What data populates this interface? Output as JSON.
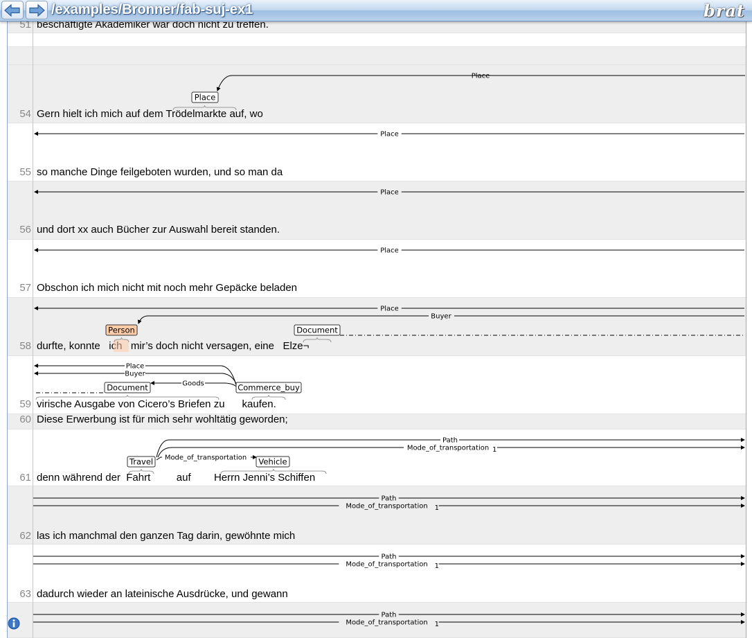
{
  "window": {
    "document_path": "/examples/Bronner/fab-suj-ex1",
    "logo": "brat",
    "nav_icons": [
      "left-arrow-icon",
      "right-arrow-icon"
    ],
    "info_icon": "info-icon"
  },
  "colors": {
    "row_even": "#eeeeee",
    "row_odd": "#ffffff",
    "span_default": "#ffffff",
    "span_person": "#ffccaa",
    "arc": "#000000"
  },
  "sentences": [
    {
      "num": "51",
      "text": "beschäftigte Akademiker war doch nicht zu treffen.",
      "shaded": true
    },
    {
      "num": "",
      "text": "",
      "shaded": false
    },
    {
      "num": "54",
      "text": "Gern hielt ich mich auf dem Trödelmarkte auf, wo",
      "shaded": true
    },
    {
      "num": "55",
      "text": "so manche Dinge feilgeboten wurden, und so man da",
      "shaded": false
    },
    {
      "num": "56",
      "text": "und dort xx auch Bücher zur Auswahl bereit standen.",
      "shaded": true
    },
    {
      "num": "57",
      "text": "Obschon ich mich nicht mit noch mehr Gepäcke beladen",
      "shaded": false
    },
    {
      "num": "58",
      "text": "durfte, konnte   ich   mir’s doch nicht versagen, eine   Elze¬",
      "shaded": true
    },
    {
      "num": "59",
      "text": "virische Ausgabe von Cicero’s Briefen zu      kaufen.",
      "shaded": false
    },
    {
      "num": "60",
      "text": "Diese Erwerbung ist für mich sehr wohltätig geworden;",
      "shaded": true
    },
    {
      "num": "61",
      "text": "denn während der  Fahrt         auf        Herrn Jenni’s Schiffen",
      "shaded": false
    },
    {
      "num": "62",
      "text": "las ich manchmal den ganzen Tag darin, gewöhnte mich",
      "shaded": true
    },
    {
      "num": "63",
      "text": "dadurch wieder an lateinische Ausdrücke, und gewann",
      "shaded": false
    },
    {
      "num": "",
      "text": "",
      "shaded": true
    }
  ],
  "spans": [
    {
      "label": "Place",
      "covers": "Trödelmarkte"
    },
    {
      "label": "Person",
      "covers": "ich"
    },
    {
      "label": "Document",
      "covers": "Elze¬"
    },
    {
      "label": "Document",
      "covers": "virische Ausgabe von Cicero’s Briefen"
    },
    {
      "label": "Commerce_buy",
      "covers": "kaufen"
    },
    {
      "label": "Travel",
      "covers": "Fahrt"
    },
    {
      "label": "Vehicle",
      "covers": "Herrn Jenni’s Schiffen"
    }
  ],
  "arcs": [
    {
      "label": "Place"
    },
    {
      "label": "Buyer"
    },
    {
      "label": "Goods"
    },
    {
      "label": "Path"
    },
    {
      "label": "Mode_of_transportation",
      "subscript": "1"
    }
  ]
}
